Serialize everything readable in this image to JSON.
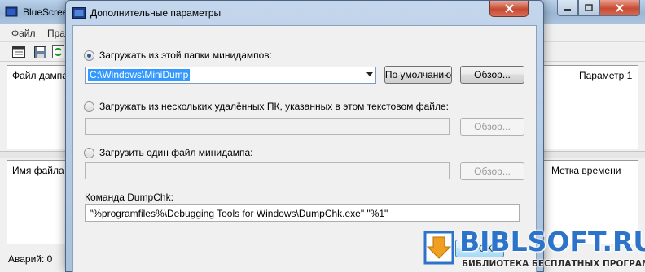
{
  "main_window": {
    "title": "BlueScree",
    "menu": [
      "Файл",
      "Пра"
    ],
    "top_pane_columns": [
      "Файл дампа",
      "Параметр 1"
    ],
    "bottom_pane_columns": [
      "Имя файла",
      "Метка времени"
    ],
    "status": "Аварий: 0"
  },
  "dialog": {
    "title": "Дополнительные параметры",
    "option_local_folder": "Загружать из этой папки минидампов:",
    "folder_value": "C:\\Windows\\MiniDump",
    "default_button": "По умолчанию",
    "browse_button": "Обзор...",
    "option_remote_pcs": "Загружать из нескольких удалённых ПК, указанных в этом текстовом файле:",
    "remote_browse_button": "Обзор...",
    "option_single_file": "Загрузить один файл минидампа:",
    "single_browse_button": "Обзор...",
    "dumpchk_label": "Команда DumpChk:",
    "dumpchk_value": "\"%programfiles%\\Debugging Tools for Windows\\DumpChk.exe\" \"%1\"",
    "ok_button": "OK"
  },
  "watermark": {
    "brand": "BIBLSOFT.RU",
    "tagline": "БИБЛИОТЕКА БЕСПЛАТНЫХ ПРОГРАММ"
  },
  "colors": {
    "selection": "#3399ff",
    "brand_blue": "#2c74c9",
    "close_red": "#c64a31"
  }
}
